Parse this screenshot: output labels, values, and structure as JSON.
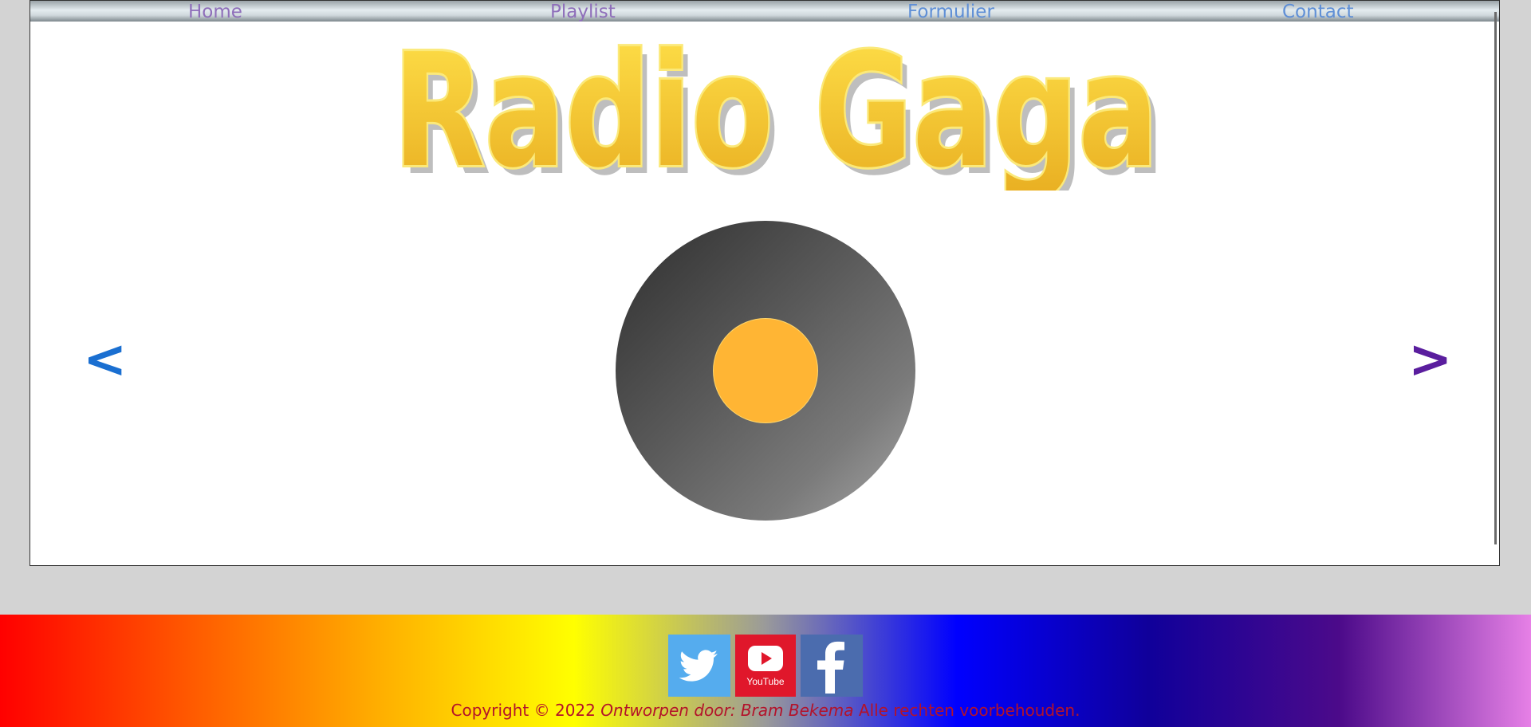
{
  "nav": {
    "items": [
      {
        "label": "Home",
        "color": "#8f6fba"
      },
      {
        "label": "Playlist",
        "color": "#8f6fba"
      },
      {
        "label": "Formulier",
        "color": "#5f8fd6"
      },
      {
        "label": "Contact",
        "color": "#5f8fd6"
      }
    ]
  },
  "logo": {
    "text": "Radio Gaga",
    "colors": {
      "fill": "#f5c329",
      "outline": "#fbe97a"
    }
  },
  "carousel": {
    "prev_label": "<",
    "next_label": ">",
    "prev_color": "#1a6fd1",
    "next_color": "#5a1e9e",
    "record": {
      "label_color": "#ffb534"
    }
  },
  "social": {
    "twitter": {
      "icon": "twitter-bird-icon",
      "color": "#55acee"
    },
    "youtube": {
      "icon": "youtube-play-icon",
      "label": "YouTube",
      "color": "#e0172b"
    },
    "facebook": {
      "icon": "facebook-f-icon",
      "color": "#4b6cae"
    }
  },
  "footer": {
    "copyright_prefix": "Copyright © 2022",
    "credit": "Ontworpen door: Bram Bekema",
    "rights": "Alle rechten voorbehouden.",
    "text_color": "#b3122a",
    "gradient": [
      "#ff0000",
      "#ff5a00",
      "#ffb000",
      "#ffff00",
      "#9a9a9a",
      "#0000ff",
      "#10009a",
      "#4c0a8a",
      "#e680e6"
    ]
  }
}
